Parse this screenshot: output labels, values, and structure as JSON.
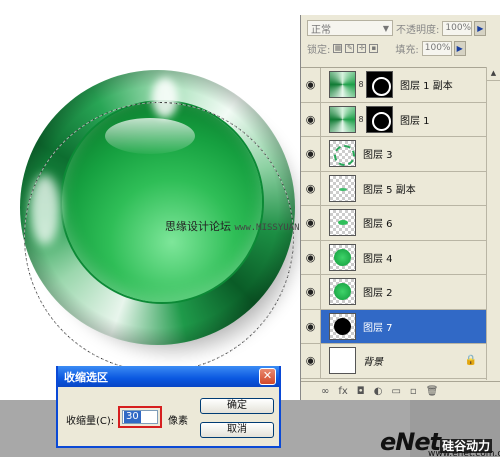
{
  "layers_panel": {
    "blend_mode": "正常",
    "opacity_label": "不透明度:",
    "opacity_value": "100%",
    "lock_label": "锁定:",
    "fill_label": "填充:",
    "fill_value": "100%",
    "layers": [
      {
        "name": "图层 1 副本",
        "thumb": "green",
        "has_mask": true,
        "selected": false,
        "locked": false,
        "italic": false
      },
      {
        "name": "图层 1",
        "thumb": "green",
        "has_mask": true,
        "selected": false,
        "locked": false,
        "italic": false
      },
      {
        "name": "图层 3",
        "thumb": "ring",
        "has_mask": false,
        "selected": false,
        "locked": false,
        "italic": false
      },
      {
        "name": "图层 5 副本",
        "thumb": "smallarc",
        "has_mask": false,
        "selected": false,
        "locked": false,
        "italic": false
      },
      {
        "name": "图层 6",
        "thumb": "arc",
        "has_mask": false,
        "selected": false,
        "locked": false,
        "italic": false
      },
      {
        "name": "图层 4",
        "thumb": "greenball",
        "has_mask": false,
        "selected": false,
        "locked": false,
        "italic": false
      },
      {
        "name": "图层 2",
        "thumb": "greenball",
        "has_mask": false,
        "selected": false,
        "locked": false,
        "italic": false
      },
      {
        "name": "图层 7",
        "thumb": "black-dot",
        "has_mask": false,
        "selected": true,
        "locked": false,
        "italic": false
      },
      {
        "name": "背景",
        "thumb": "white",
        "has_mask": false,
        "selected": false,
        "locked": true,
        "italic": true
      }
    ],
    "bottom_icons": [
      "link-icon",
      "fx-icon",
      "mask-icon",
      "adjustment-icon",
      "folder-icon",
      "new-layer-icon",
      "trash-icon"
    ],
    "bottom_glyphs": [
      "∞",
      "fx",
      "◘",
      "◐",
      "▭",
      "▫",
      "🗑"
    ]
  },
  "watermark": {
    "text": "思缘设计论坛",
    "url": "www.MISSYUAN.com"
  },
  "contract_dialog": {
    "title": "收缩选区",
    "close_glyph": "✕",
    "label": "收缩量(C):",
    "value": "30",
    "unit": "像素",
    "ok_label": "确定",
    "cancel_label": "取消"
  },
  "logo": {
    "brand": "eNet",
    "cn": "硅谷动力",
    "domain": "www.enet.com.cn"
  },
  "colors": {
    "selection_blue": "#3169c6",
    "dialog_titlebar": "#0a57e0",
    "button_green": "#16a040",
    "highlight_red": "#d61f1f"
  }
}
